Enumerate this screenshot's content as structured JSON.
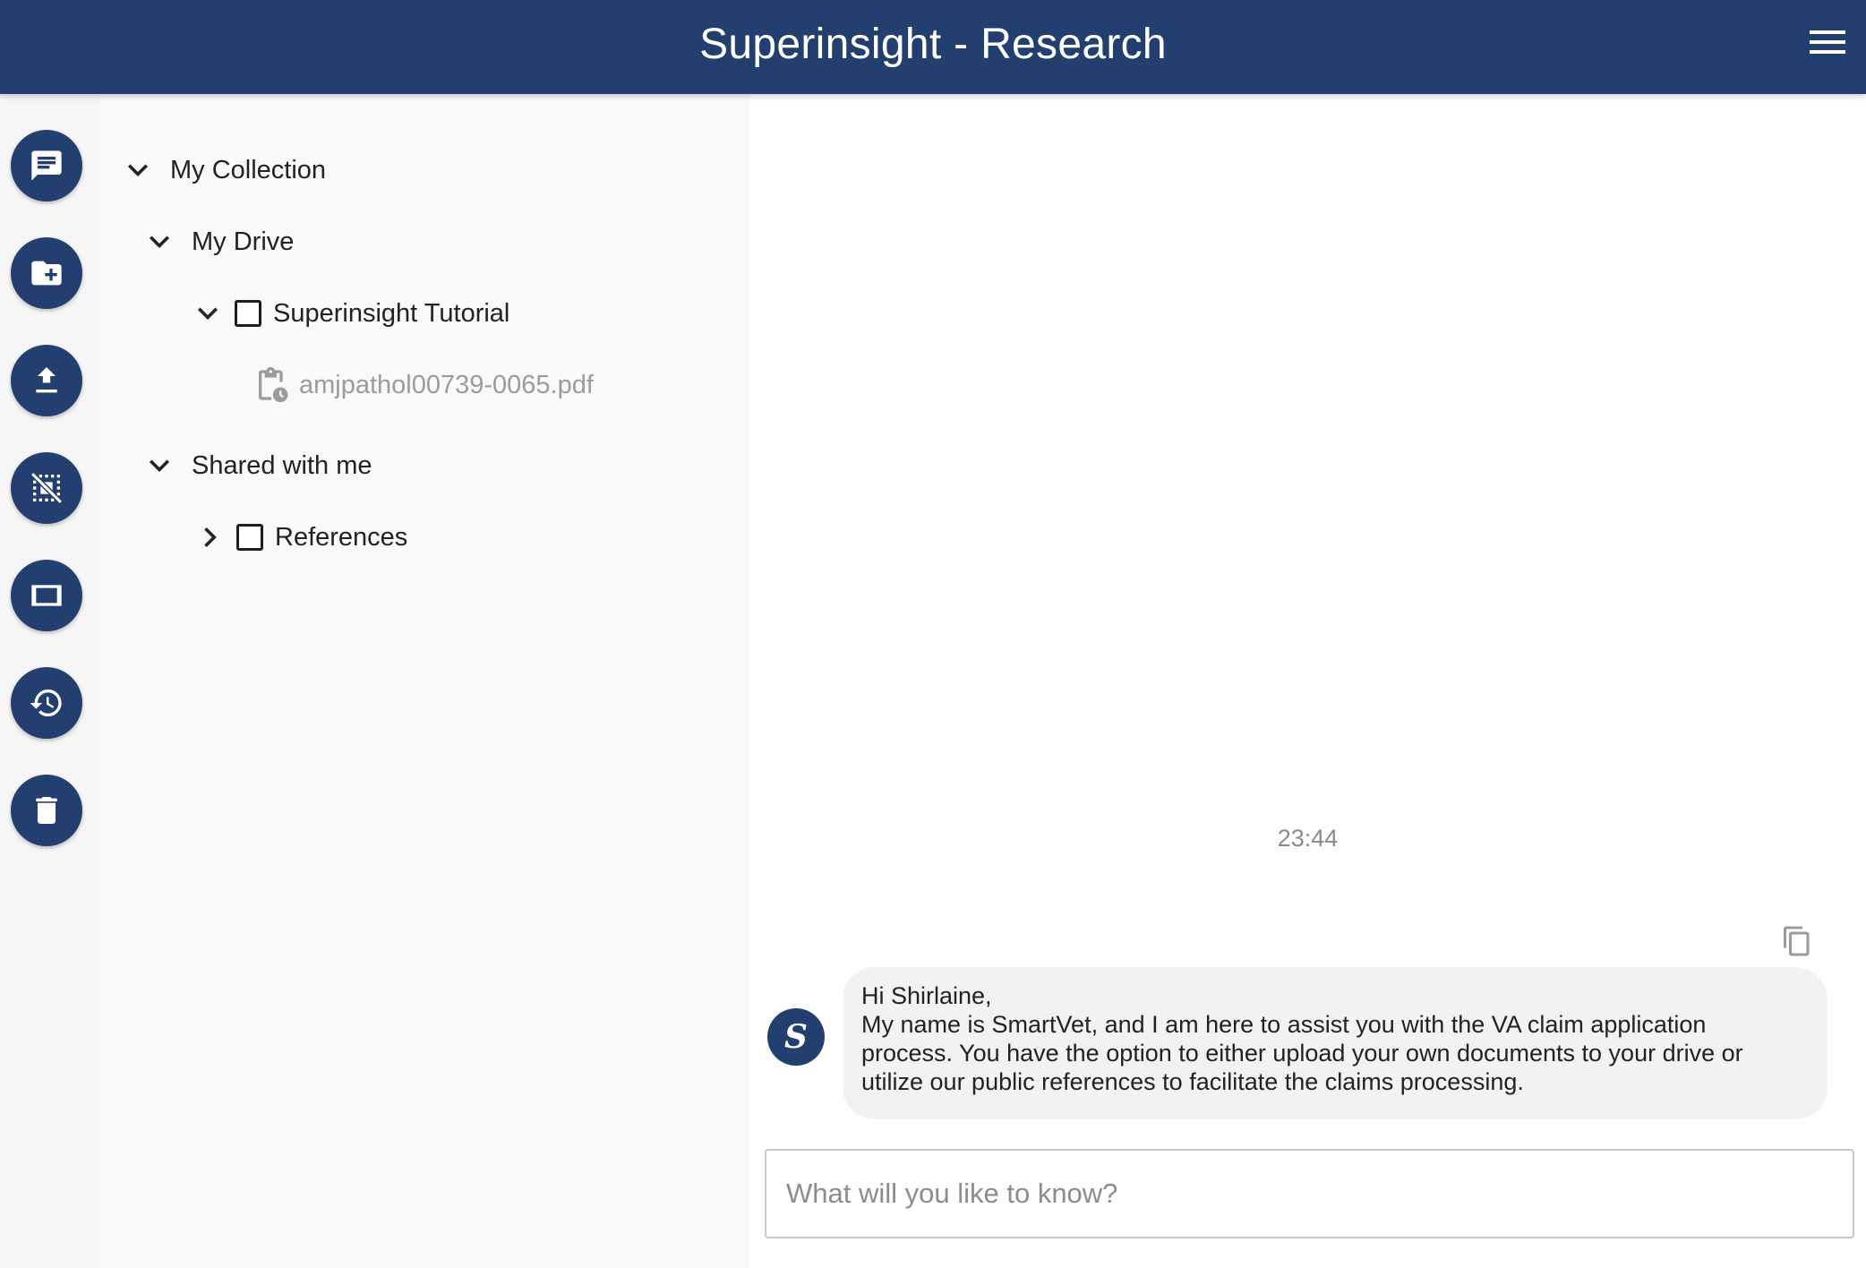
{
  "header": {
    "title": "Superinsight - Research"
  },
  "rail": {
    "buttons": [
      {
        "icon": "chat-icon"
      },
      {
        "icon": "new-folder-icon"
      },
      {
        "icon": "upload-icon"
      },
      {
        "icon": "deselect-icon"
      },
      {
        "icon": "panel-icon"
      },
      {
        "icon": "history-icon"
      },
      {
        "icon": "delete-icon"
      }
    ]
  },
  "tree": {
    "root_label": "My Collection",
    "my_drive_label": "My Drive",
    "tutorial_folder_label": "Superinsight Tutorial",
    "file_label": "amjpathol00739-0065.pdf",
    "shared_label": "Shared with me",
    "references_label": "References"
  },
  "chat": {
    "timestamp": "23:44",
    "avatar_letter": "S",
    "message_lines": [
      "Hi Shirlaine,",
      "My name is SmartVet, and I am here to assist you with the VA claim application",
      "process. You have the option to either upload your own documents to your drive or",
      "utilize our public references to facilitate the claims processing."
    ],
    "input_placeholder": "What will you like to know?",
    "input_value": ""
  },
  "colors": {
    "brand": "#233f70",
    "tree_background": "#f9f9f9",
    "rail_background": "#f6f6f6",
    "bubble_background": "#f2f2f2"
  }
}
